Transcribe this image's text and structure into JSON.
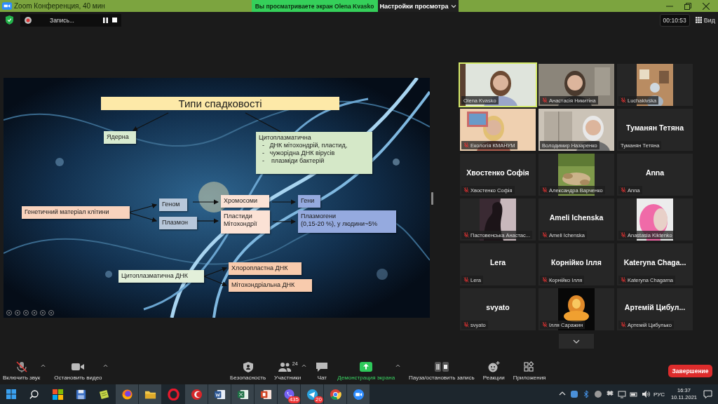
{
  "title_bar": {
    "title": "Zoom Конференция, 40 мин",
    "share_banner": "Вы просматриваете экран Olena Kvasko",
    "view_options": "Настройки просмотра"
  },
  "meeting_bar": {
    "recording_label": "Запись...",
    "timer": "00:10:53",
    "view_button": "Вид"
  },
  "slide": {
    "title": "Типи спадковості",
    "boxes": [
      {
        "lines": [
          "Ядерна"
        ],
        "color": "#d8ebd0"
      },
      {
        "lines": [
          "Цитоплазматична",
          "  -   ДНК мітохондрій, пластид,",
          "  -   чужорідна ДНК вірусів",
          "  -    плазміди бактерій"
        ],
        "color": "#d5e8c8"
      },
      {
        "lines": [
          "Генетичний матеріал клітини"
        ],
        "color": "#f9d3bd"
      },
      {
        "lines": [
          "Геном"
        ],
        "color": "#b7c7da"
      },
      {
        "lines": [
          "Плазмон"
        ],
        "color": "#b7c7da"
      },
      {
        "lines": [
          "Хромосоми"
        ],
        "color": "#fbe2d5"
      },
      {
        "lines": [
          "Пластиди",
          "Мітохондрії"
        ],
        "color": "#fbe2d5"
      },
      {
        "lines": [
          "Гени"
        ],
        "color": "#95aadf"
      },
      {
        "lines": [
          "Плазмогени",
          "(0,15-20 %), у людини~5%"
        ],
        "color": "#95aadf"
      },
      {
        "lines": [
          "Цитоплазматична ДНК"
        ],
        "color": "#e3f0da"
      },
      {
        "lines": [
          "Хлоропластна ДНК"
        ],
        "color": "#f8cbad"
      },
      {
        "lines": [
          "Мітохондріальна ДНК"
        ],
        "color": "#f8cbad"
      }
    ]
  },
  "participants": [
    {
      "name": "Olena Kvasko",
      "kind": "video",
      "muted": false,
      "speaking": true
    },
    {
      "name": "Анастасія Никитіна",
      "kind": "video",
      "muted": true,
      "speaking": false
    },
    {
      "name": "Luchakivska",
      "kind": "avatar",
      "muted": true,
      "speaking": false
    },
    {
      "name": "Екологія КМАНУМ",
      "kind": "video",
      "muted": true,
      "speaking": false
    },
    {
      "name": "Володимир Назаренко",
      "kind": "video",
      "muted": false,
      "speaking": false
    },
    {
      "name": "Туманян Тетяна",
      "display": "Туманян Тетяна",
      "kind": "name",
      "muted": false,
      "speaking": false
    },
    {
      "name": "Хвостенко Софія",
      "display": "Хвостенко Софія",
      "kind": "name",
      "muted": true,
      "speaking": false
    },
    {
      "name": "Александра Варченко",
      "kind": "avatar",
      "muted": true,
      "speaking": false
    },
    {
      "name": "Anna",
      "display": "Anna",
      "kind": "name",
      "muted": true,
      "speaking": false
    },
    {
      "name": "Пастовенська Анастас...",
      "kind": "avatar",
      "muted": true,
      "speaking": false
    },
    {
      "name": "Ameli Ichenska",
      "display": "Ameli Ichenska",
      "kind": "name",
      "muted": true,
      "speaking": false
    },
    {
      "name": "Anastasia Kiktenko",
      "kind": "avatar",
      "muted": true,
      "speaking": false
    },
    {
      "name": "Lera",
      "display": "Lera",
      "kind": "name",
      "muted": true,
      "speaking": false
    },
    {
      "name": "Корнійко Ілля",
      "display": "Корнійко Ілля",
      "kind": "name",
      "muted": true,
      "speaking": false
    },
    {
      "name": "Kateryna Chagarna",
      "display": "Kateryna Chaga...",
      "kind": "name",
      "muted": true,
      "speaking": false
    },
    {
      "name": "svyato",
      "display": "svyato",
      "kind": "name",
      "muted": true,
      "speaking": false
    },
    {
      "name": "Ілля Саражин",
      "kind": "avatar",
      "muted": true,
      "speaking": false
    },
    {
      "name": "Артемій Цибулько",
      "display": "Артемій Цибул...",
      "kind": "name",
      "muted": true,
      "speaking": false
    }
  ],
  "toolbar": {
    "items": [
      {
        "kind": "mic_muted",
        "label": "Включить звук",
        "menu": true,
        "active": false
      },
      {
        "kind": "camera",
        "label": "Остановить видео",
        "menu": true,
        "active": false
      },
      {
        "kind": "shield",
        "label": "Безопасность",
        "menu": false,
        "active": false
      },
      {
        "kind": "people",
        "label": "Участники",
        "count": "24",
        "menu": true,
        "active": false
      },
      {
        "kind": "chat",
        "label": "Чат",
        "menu": false,
        "active": false
      },
      {
        "kind": "share",
        "label": "Демонстрация экрана",
        "menu": true,
        "active": true
      },
      {
        "kind": "record",
        "label": "Пауза/остановить запись",
        "menu": false,
        "active": false
      },
      {
        "kind": "reactions",
        "label": "Реакции",
        "menu": false,
        "active": false
      },
      {
        "kind": "apps",
        "label": "Приложения",
        "menu": false,
        "active": false
      }
    ],
    "end_button": "Завершение"
  },
  "taskbar": {
    "apps": [
      {
        "kind": "tiles",
        "open": false
      },
      {
        "kind": "floppy",
        "open": false
      },
      {
        "kind": "notes",
        "open": false
      },
      {
        "kind": "browser",
        "open": true
      },
      {
        "kind": "folder",
        "open": true
      },
      {
        "kind": "ring",
        "open": false
      },
      {
        "kind": "crescent",
        "open": true
      },
      {
        "kind": "document",
        "open": true
      },
      {
        "kind": "spreadsheet",
        "open": true
      },
      {
        "kind": "slides",
        "open": true
      },
      {
        "kind": "phone",
        "open": true,
        "badge": "435"
      },
      {
        "kind": "plane",
        "open": true,
        "badge": "20"
      },
      {
        "kind": "wheel",
        "open": true
      },
      {
        "kind": "camera",
        "open": true
      }
    ],
    "tray": {
      "language": "РУС",
      "time": "16:37",
      "date": "10.11.2021"
    }
  }
}
